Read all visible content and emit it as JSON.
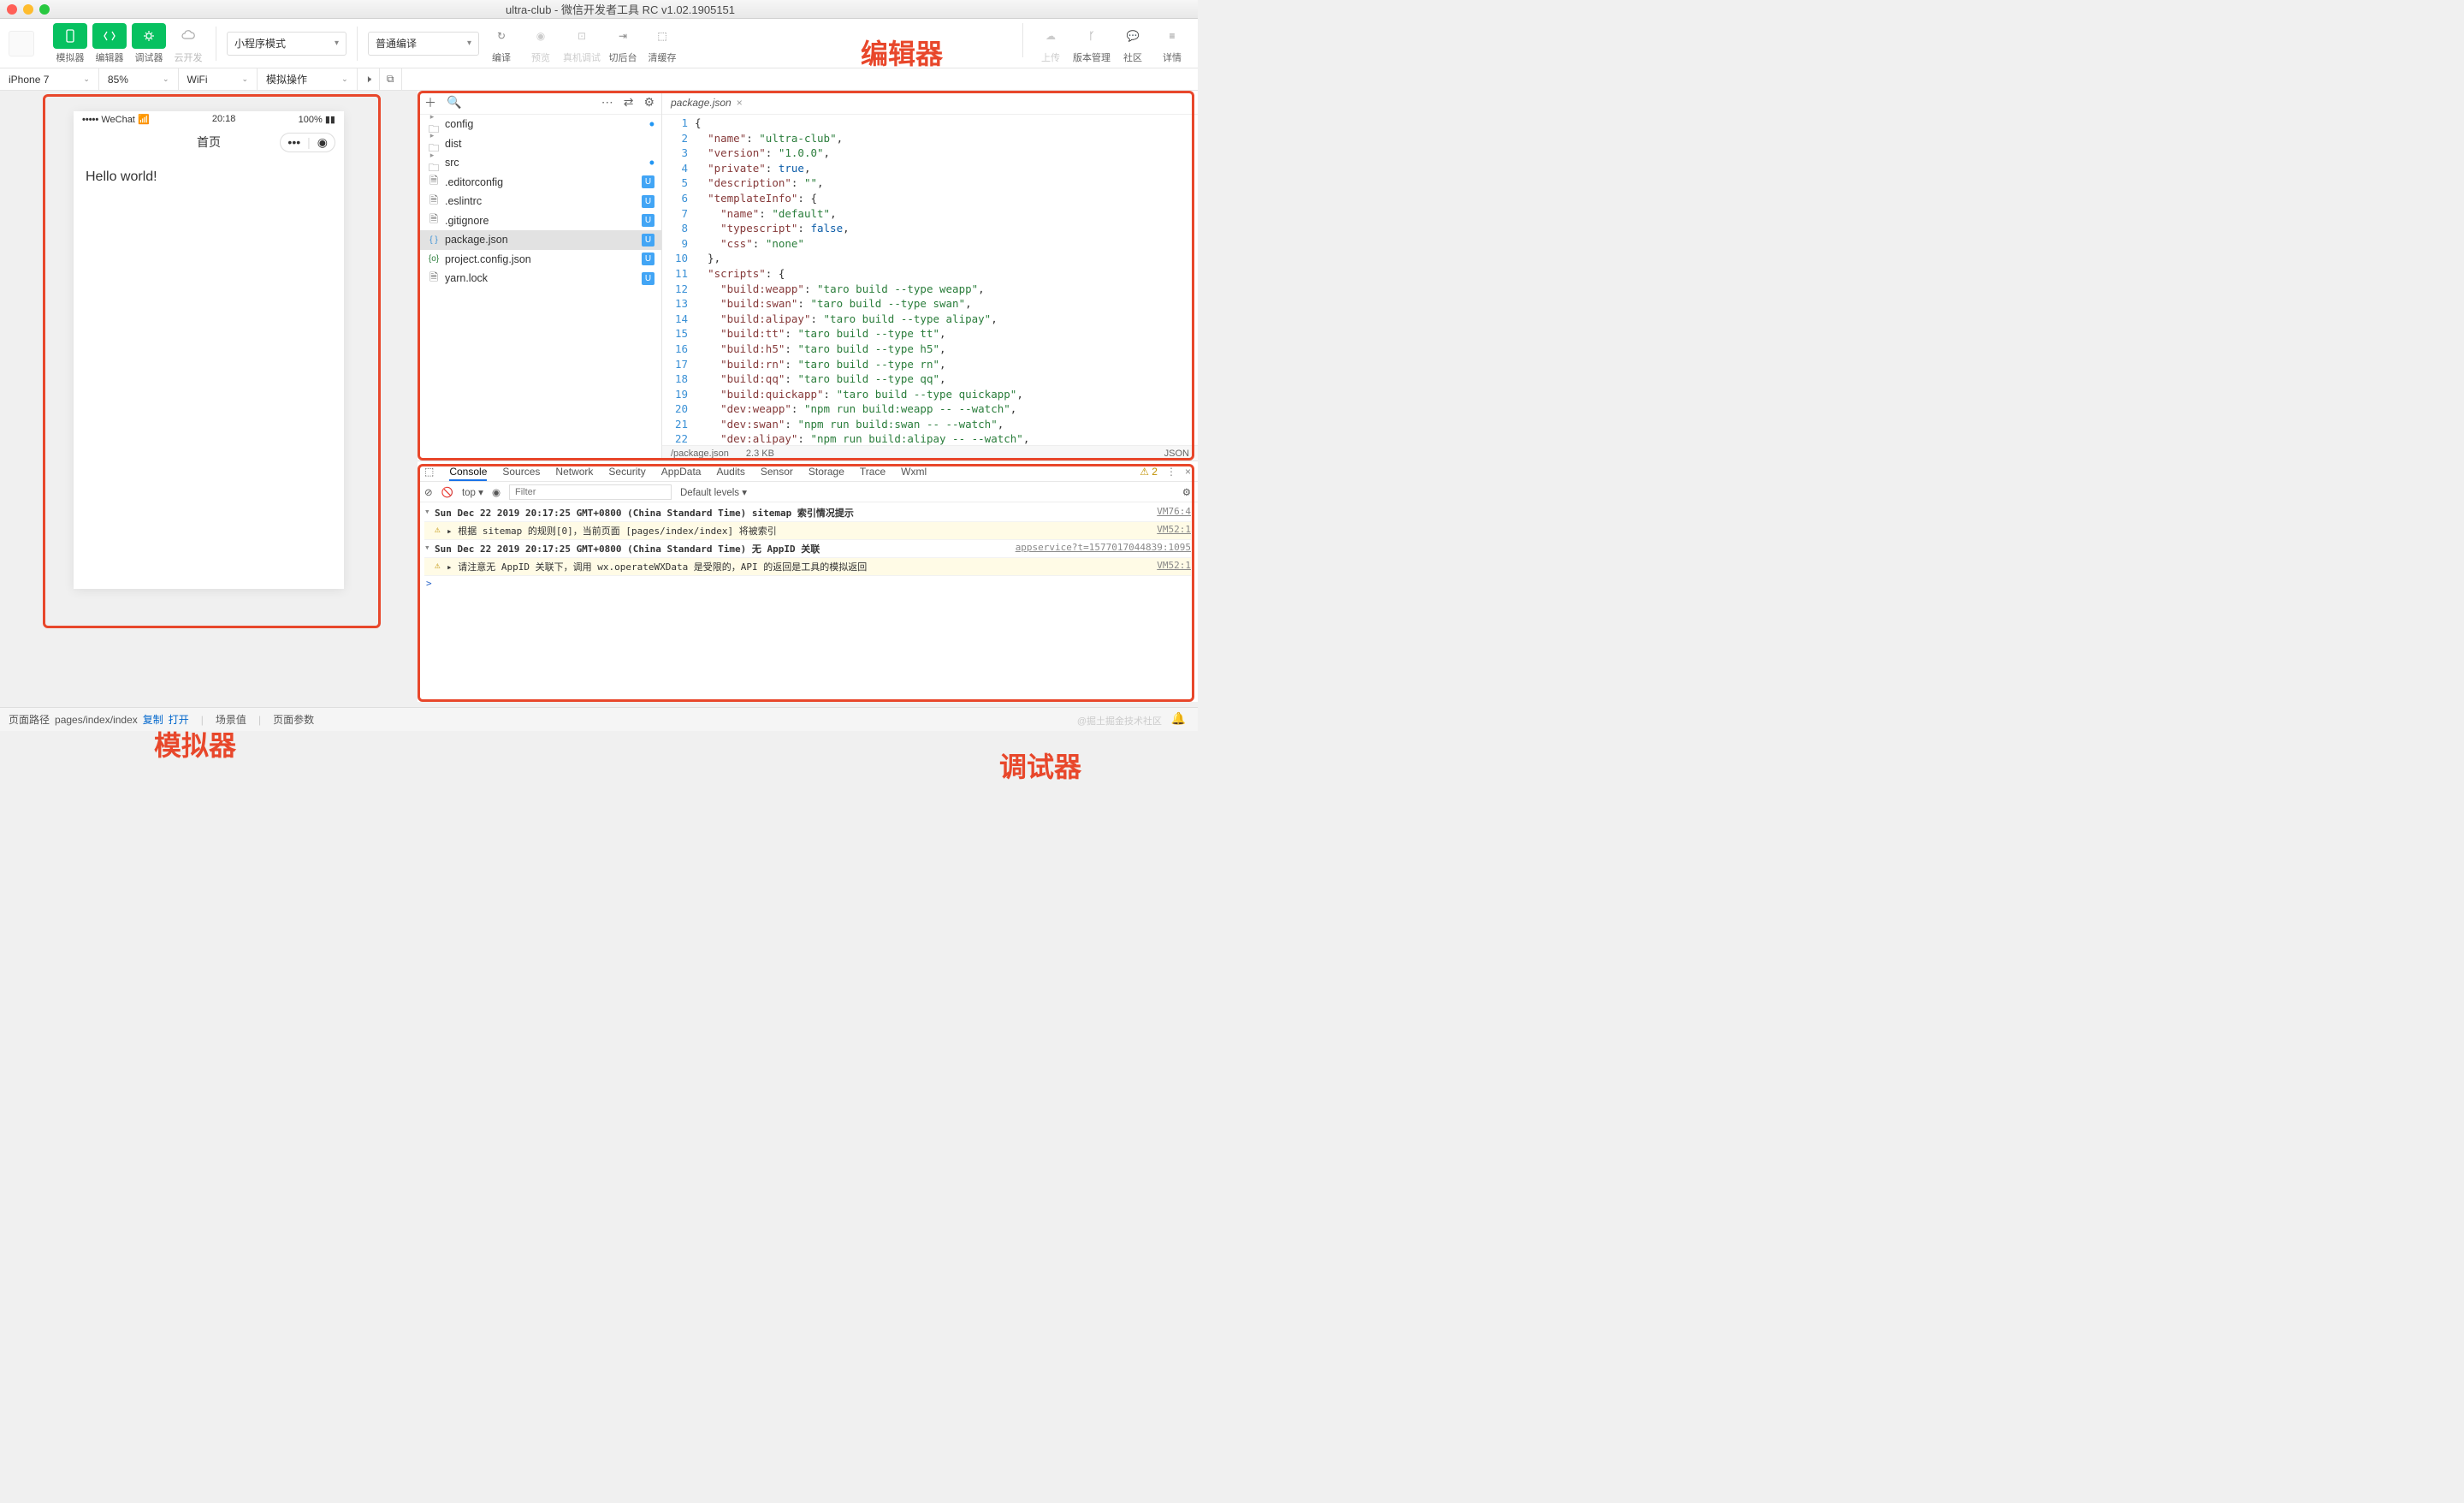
{
  "window": {
    "title": "ultra-club - 微信开发者工具 RC v1.02.1905151"
  },
  "annotations": {
    "editor": "编辑器",
    "simulator": "模拟器",
    "debugger": "调试器"
  },
  "toolbar": {
    "simulator": "模拟器",
    "editor": "编辑器",
    "debugger": "调试器",
    "cloud": "云开发",
    "mode_select": "小程序模式",
    "compile_select": "普通编译",
    "compile": "编译",
    "preview": "预览",
    "remote": "真机调试",
    "background": "切后台",
    "cache": "清缓存",
    "upload": "上传",
    "vcs": "版本管理",
    "community": "社区",
    "details": "详情"
  },
  "simbar": {
    "device": "iPhone 7",
    "zoom": "85%",
    "network": "WiFi",
    "action": "模拟操作"
  },
  "phone": {
    "carrier": "WeChat",
    "time": "20:18",
    "battery": "100%",
    "nav_title": "首页",
    "content": "Hello world!"
  },
  "filetree": {
    "items": [
      {
        "type": "folder",
        "name": "config",
        "status": "dot"
      },
      {
        "type": "folder",
        "name": "dist"
      },
      {
        "type": "folder",
        "name": "src",
        "status": "dot"
      },
      {
        "type": "file",
        "name": ".editorconfig",
        "badge": "U"
      },
      {
        "type": "file",
        "name": ".eslintrc",
        "badge": "U"
      },
      {
        "type": "file",
        "name": ".gitignore",
        "badge": "U"
      },
      {
        "type": "file",
        "name": "package.json",
        "badge": "U",
        "selected": true,
        "glyph": "{ }"
      },
      {
        "type": "file",
        "name": "project.config.json",
        "badge": "U",
        "glyph": "{o}"
      },
      {
        "type": "file",
        "name": "yarn.lock",
        "badge": "U"
      }
    ]
  },
  "editor": {
    "tab": "package.json",
    "status_path": "/package.json",
    "status_size": "2.3 KB",
    "status_lang": "JSON",
    "code": [
      [
        [
          "cp",
          "{"
        ]
      ],
      [
        [
          "cp",
          "  "
        ],
        [
          "ck",
          "\"name\""
        ],
        [
          "cp",
          ": "
        ],
        [
          "cs",
          "\"ultra-club\""
        ],
        [
          "cp",
          ","
        ]
      ],
      [
        [
          "cp",
          "  "
        ],
        [
          "ck",
          "\"version\""
        ],
        [
          "cp",
          ": "
        ],
        [
          "cs",
          "\"1.0.0\""
        ],
        [
          "cp",
          ","
        ]
      ],
      [
        [
          "cp",
          "  "
        ],
        [
          "ck",
          "\"private\""
        ],
        [
          "cp",
          ": "
        ],
        [
          "cv",
          "true"
        ],
        [
          "cp",
          ","
        ]
      ],
      [
        [
          "cp",
          "  "
        ],
        [
          "ck",
          "\"description\""
        ],
        [
          "cp",
          ": "
        ],
        [
          "cs",
          "\"\""
        ],
        [
          "cp",
          ","
        ]
      ],
      [
        [
          "cp",
          "  "
        ],
        [
          "ck",
          "\"templateInfo\""
        ],
        [
          "cp",
          ": {"
        ]
      ],
      [
        [
          "cp",
          "    "
        ],
        [
          "ck",
          "\"name\""
        ],
        [
          "cp",
          ": "
        ],
        [
          "cs",
          "\"default\""
        ],
        [
          "cp",
          ","
        ]
      ],
      [
        [
          "cp",
          "    "
        ],
        [
          "ck",
          "\"typescript\""
        ],
        [
          "cp",
          ": "
        ],
        [
          "cv",
          "false"
        ],
        [
          "cp",
          ","
        ]
      ],
      [
        [
          "cp",
          "    "
        ],
        [
          "ck",
          "\"css\""
        ],
        [
          "cp",
          ": "
        ],
        [
          "cs",
          "\"none\""
        ]
      ],
      [
        [
          "cp",
          "  },"
        ]
      ],
      [
        [
          "cp",
          "  "
        ],
        [
          "ck",
          "\"scripts\""
        ],
        [
          "cp",
          ": {"
        ]
      ],
      [
        [
          "cp",
          "    "
        ],
        [
          "ck",
          "\"build:weapp\""
        ],
        [
          "cp",
          ": "
        ],
        [
          "cs",
          "\"taro build --type weapp\""
        ],
        [
          "cp",
          ","
        ]
      ],
      [
        [
          "cp",
          "    "
        ],
        [
          "ck",
          "\"build:swan\""
        ],
        [
          "cp",
          ": "
        ],
        [
          "cs",
          "\"taro build --type swan\""
        ],
        [
          "cp",
          ","
        ]
      ],
      [
        [
          "cp",
          "    "
        ],
        [
          "ck",
          "\"build:alipay\""
        ],
        [
          "cp",
          ": "
        ],
        [
          "cs",
          "\"taro build --type alipay\""
        ],
        [
          "cp",
          ","
        ]
      ],
      [
        [
          "cp",
          "    "
        ],
        [
          "ck",
          "\"build:tt\""
        ],
        [
          "cp",
          ": "
        ],
        [
          "cs",
          "\"taro build --type tt\""
        ],
        [
          "cp",
          ","
        ]
      ],
      [
        [
          "cp",
          "    "
        ],
        [
          "ck",
          "\"build:h5\""
        ],
        [
          "cp",
          ": "
        ],
        [
          "cs",
          "\"taro build --type h5\""
        ],
        [
          "cp",
          ","
        ]
      ],
      [
        [
          "cp",
          "    "
        ],
        [
          "ck",
          "\"build:rn\""
        ],
        [
          "cp",
          ": "
        ],
        [
          "cs",
          "\"taro build --type rn\""
        ],
        [
          "cp",
          ","
        ]
      ],
      [
        [
          "cp",
          "    "
        ],
        [
          "ck",
          "\"build:qq\""
        ],
        [
          "cp",
          ": "
        ],
        [
          "cs",
          "\"taro build --type qq\""
        ],
        [
          "cp",
          ","
        ]
      ],
      [
        [
          "cp",
          "    "
        ],
        [
          "ck",
          "\"build:quickapp\""
        ],
        [
          "cp",
          ": "
        ],
        [
          "cs",
          "\"taro build --type quickapp\""
        ],
        [
          "cp",
          ","
        ]
      ],
      [
        [
          "cp",
          "    "
        ],
        [
          "ck",
          "\"dev:weapp\""
        ],
        [
          "cp",
          ": "
        ],
        [
          "cs",
          "\"npm run build:weapp -- --watch\""
        ],
        [
          "cp",
          ","
        ]
      ],
      [
        [
          "cp",
          "    "
        ],
        [
          "ck",
          "\"dev:swan\""
        ],
        [
          "cp",
          ": "
        ],
        [
          "cs",
          "\"npm run build:swan -- --watch\""
        ],
        [
          "cp",
          ","
        ]
      ],
      [
        [
          "cp",
          "    "
        ],
        [
          "ck",
          "\"dev:alipay\""
        ],
        [
          "cp",
          ": "
        ],
        [
          "cs",
          "\"npm run build:alipay -- --watch\""
        ],
        [
          "cp",
          ","
        ]
      ]
    ]
  },
  "devtools": {
    "tabs": [
      "Console",
      "Sources",
      "Network",
      "Security",
      "AppData",
      "Audits",
      "Sensor",
      "Storage",
      "Trace",
      "Wxml"
    ],
    "warn_count": "2",
    "context": "top",
    "levels": "Default levels ▾",
    "filter_ph": "Filter",
    "log": [
      {
        "type": "group",
        "msg": "Sun Dec 22 2019 20:17:25 GMT+0800 (China Standard Time) sitemap 索引情况提示",
        "src": "VM76:4"
      },
      {
        "type": "warn",
        "msg": "▸ 根据 sitemap 的规则[0]，当前页面 [pages/index/index] 将被索引",
        "src": "VM52:1"
      },
      {
        "type": "group",
        "msg": "Sun Dec 22 2019 20:17:25 GMT+0800 (China Standard Time) 无 AppID 关联",
        "src": "appservice?t=1577017044839:1095"
      },
      {
        "type": "warn",
        "msg": "▸ 请注意无 AppID 关联下，调用 wx.operateWXData 是受限的，API 的返回是工具的模拟返回",
        "src": "VM52:1"
      }
    ]
  },
  "bottombar": {
    "path_label": "页面路径",
    "path": "pages/index/index",
    "copy": "复制",
    "open": "打开",
    "scene": "场景值",
    "params": "页面参数"
  },
  "watermark": "@掘土掘金技术社区"
}
